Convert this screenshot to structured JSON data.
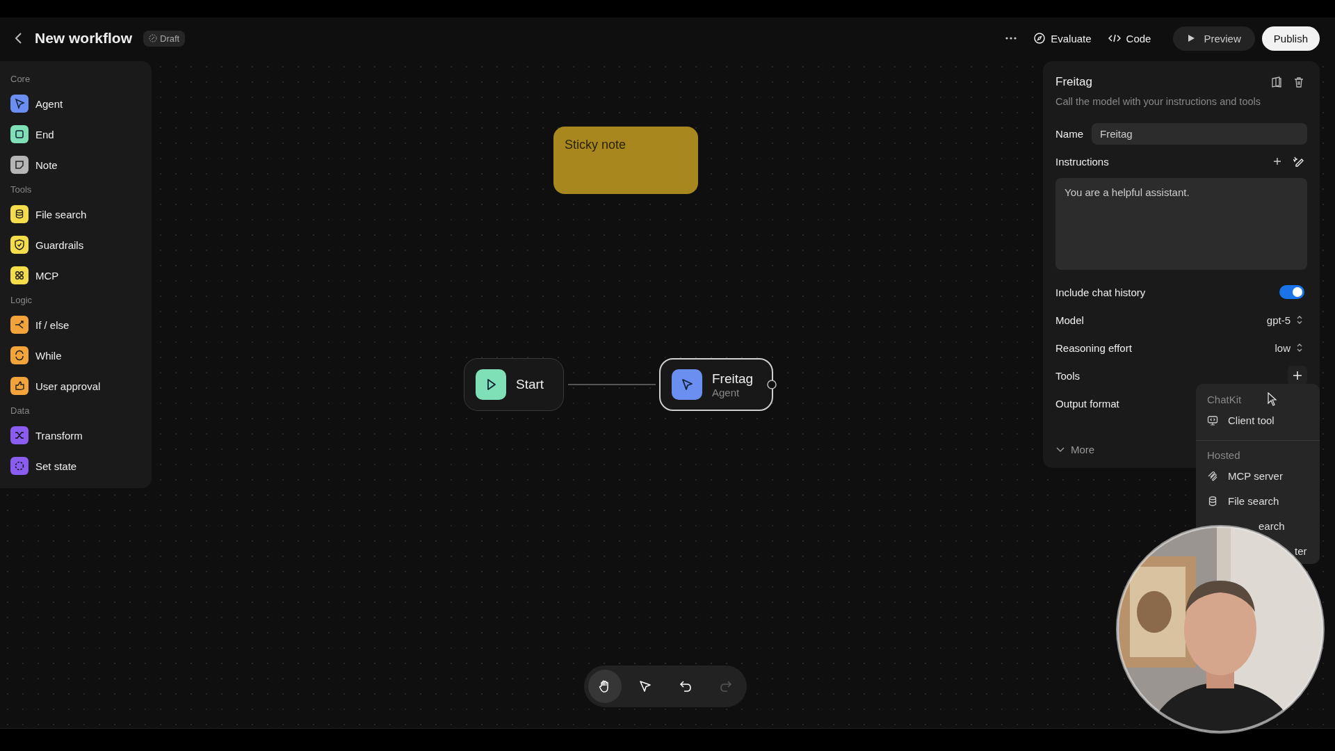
{
  "header": {
    "title": "New workflow",
    "badge": "Draft",
    "actions": [
      {
        "label": "Evaluate",
        "kind": "evaluate"
      },
      {
        "label": "Code",
        "kind": "code"
      },
      {
        "label": "Preview",
        "kind": "preview"
      },
      {
        "label": "Publish",
        "kind": "publish"
      }
    ]
  },
  "sidebar": {
    "sections": [
      {
        "title": "Core",
        "items": [
          {
            "label": "Agent",
            "color": "#6b8ff0"
          },
          {
            "label": "End",
            "color": "#7fe0b8"
          },
          {
            "label": "Note",
            "color": "#b5b5b5"
          }
        ]
      },
      {
        "title": "Tools",
        "items": [
          {
            "label": "File search",
            "color": "#f5dc4a"
          },
          {
            "label": "Guardrails",
            "color": "#f5dc4a"
          },
          {
            "label": "MCP",
            "color": "#f5dc4a"
          }
        ]
      },
      {
        "title": "Logic",
        "items": [
          {
            "label": "If / else",
            "color": "#f2a33a"
          },
          {
            "label": "While",
            "color": "#f2a33a"
          },
          {
            "label": "User approval",
            "color": "#f2a33a"
          }
        ]
      },
      {
        "title": "Data",
        "items": [
          {
            "label": "Transform",
            "color": "#8b5cf0"
          },
          {
            "label": "Set state",
            "color": "#8b5cf0"
          }
        ]
      }
    ]
  },
  "canvas": {
    "sticky_note": {
      "text": "Sticky note"
    },
    "nodes": [
      {
        "kind": "start",
        "title": "Start",
        "selected": false
      },
      {
        "kind": "agent",
        "title": "Freitag",
        "subtitle": "Agent",
        "selected": true
      }
    ]
  },
  "panel": {
    "title": "Freitag",
    "description": "Call the model with your instructions and tools",
    "name": {
      "label": "Name",
      "value": "Freitag"
    },
    "instructions": {
      "label": "Instructions",
      "value": "You are a helpful assistant."
    },
    "chat_history": {
      "label": "Include chat history",
      "on": true
    },
    "model": {
      "label": "Model",
      "value": "gpt-5"
    },
    "reasoning": {
      "label": "Reasoning effort",
      "value": "low"
    },
    "tools": {
      "label": "Tools"
    },
    "output_format": {
      "label": "Output format"
    },
    "more": {
      "label": "More"
    }
  },
  "dropdown": {
    "sections": [
      {
        "title": "ChatKit",
        "items": [
          {
            "kind": "client",
            "label": "Client tool"
          }
        ]
      },
      {
        "title": "Hosted",
        "items": [
          {
            "kind": "mcp",
            "label": "MCP server"
          },
          {
            "kind": "file",
            "label": "File search"
          },
          {
            "kind": "partial",
            "label": "earch"
          },
          {
            "kind": "partial",
            "label": "ter"
          }
        ]
      }
    ]
  },
  "toolbar": [
    {
      "kind": "hand",
      "selected": true,
      "disabled": false
    },
    {
      "kind": "pointer",
      "selected": false,
      "disabled": false
    },
    {
      "kind": "undo",
      "selected": false,
      "disabled": false
    },
    {
      "kind": "redo",
      "selected": false,
      "disabled": true
    }
  ]
}
